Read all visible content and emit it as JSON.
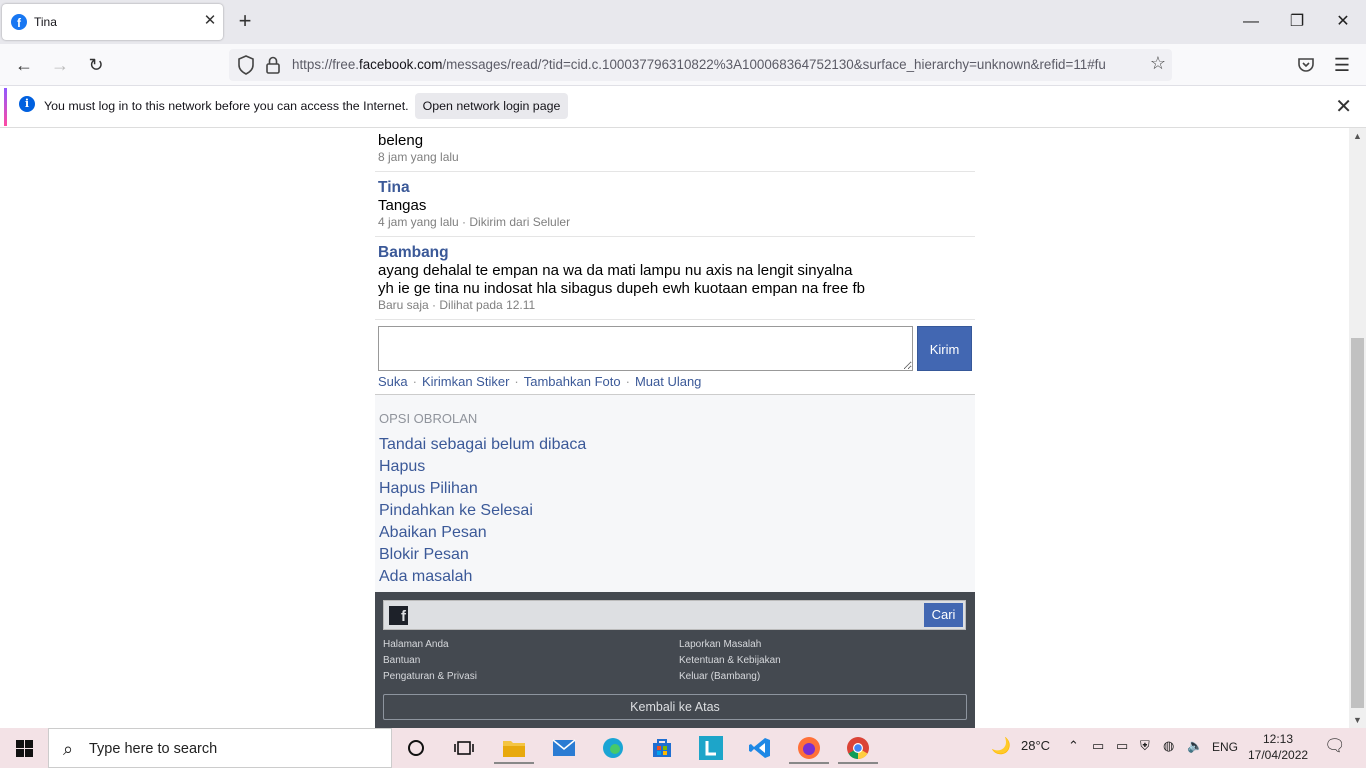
{
  "browser": {
    "tab_title": "Tina",
    "url_prefix": "https://free.",
    "url_domain": "facebook.com",
    "url_rest": "/messages/read/?tid=cid.c.100037796310822%3A100068364752130&surface_hierarchy=unknown&refid=11#fu"
  },
  "notification": {
    "message": "You must log in to this network before you can access the Internet.",
    "button": "Open network login page"
  },
  "messages": [
    {
      "sender": "",
      "text": [
        "beleng"
      ],
      "meta": "8 jam yang lalu"
    },
    {
      "sender": "Tina",
      "text": [
        "Tangas"
      ],
      "meta": "4 jam yang lalu · Dikirim dari Seluler"
    },
    {
      "sender": "Bambang",
      "text": [
        "ayang dehalal te empan na wa da mati lampu nu axis na lengit sinyalna",
        "yh ie ge tina nu indosat hla sibagus dupeh ewh kuotaan empan na free fb"
      ],
      "meta": "Baru saja · Dilihat pada 12.11"
    }
  ],
  "compose": {
    "send": "Kirim",
    "links": [
      "Suka",
      "Kirimkan Stiker",
      "Tambahkan Foto",
      "Muat Ulang"
    ]
  },
  "options": {
    "heading": "OPSI OBROLAN",
    "items": [
      "Tandai sebagai belum dibaca",
      "Hapus",
      "Hapus Pilihan",
      "Pindahkan ke Selesai",
      "Abaikan Pesan",
      "Blokir Pesan",
      "Ada masalah"
    ]
  },
  "footer": {
    "search_button": "Cari",
    "left_links": [
      "Halaman Anda",
      "Bantuan",
      "Pengaturan & Privasi"
    ],
    "right_links": [
      "Laporkan Masalah",
      "Ketentuan & Kebijakan",
      "Keluar (Bambang)"
    ],
    "back_to_top": "Kembali ke Atas"
  },
  "taskbar": {
    "search_placeholder": "Type here to search",
    "temperature": "28°C",
    "language": "ENG",
    "time": "12:13",
    "date": "17/04/2022"
  },
  "colors": {
    "fb_blue": "#3b5998",
    "button_blue": "#4267b2",
    "footer_bg": "#444950"
  }
}
